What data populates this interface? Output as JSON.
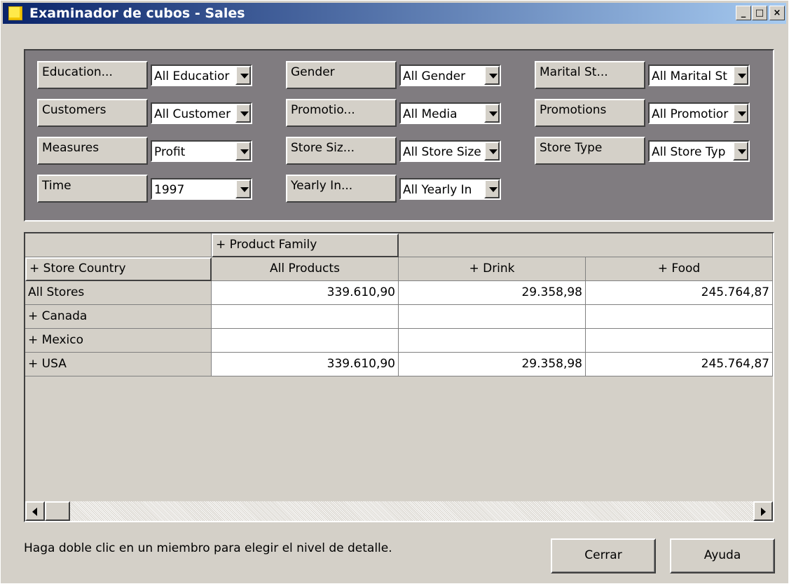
{
  "window": {
    "title": "Examinador de cubos - Sales",
    "minimize": "_",
    "maximize": "□",
    "close": "×"
  },
  "dimensions": [
    {
      "name": "Education...",
      "value": "All Educatior"
    },
    {
      "name": "Customers",
      "value": "All Customer"
    },
    {
      "name": "Measures",
      "value": "Profit"
    },
    {
      "name": "Time",
      "value": "1997"
    },
    {
      "name": "Gender",
      "value": "All Gender"
    },
    {
      "name": "Promotio...",
      "value": "All Media"
    },
    {
      "name": "Store Siz...",
      "value": "All Store Size"
    },
    {
      "name": "Yearly In...",
      "value": "All Yearly In"
    },
    {
      "name": "Marital St...",
      "value": "All Marital St"
    },
    {
      "name": "Promotions",
      "value": "All Promotior"
    },
    {
      "name": "Store Type",
      "value": "All Store Typ"
    }
  ],
  "grid": {
    "column_dimension": "+ Product Family",
    "row_dimension": "+ Store Country",
    "columns": [
      "All Products",
      "+  Drink",
      "+  Food"
    ],
    "rows": [
      {
        "label": "All Stores",
        "values": [
          "339.610,90",
          "29.358,98",
          "245.764,87"
        ]
      },
      {
        "label": "+  Canada",
        "values": [
          "",
          "",
          ""
        ]
      },
      {
        "label": "+  Mexico",
        "values": [
          "",
          "",
          ""
        ]
      },
      {
        "label": "+  USA",
        "values": [
          "339.610,90",
          "29.358,98",
          "245.764,87"
        ]
      }
    ]
  },
  "status_text": "Haga doble clic en un miembro para elegir el nivel de detalle.",
  "buttons": {
    "close": "Cerrar",
    "help": "Ayuda"
  }
}
